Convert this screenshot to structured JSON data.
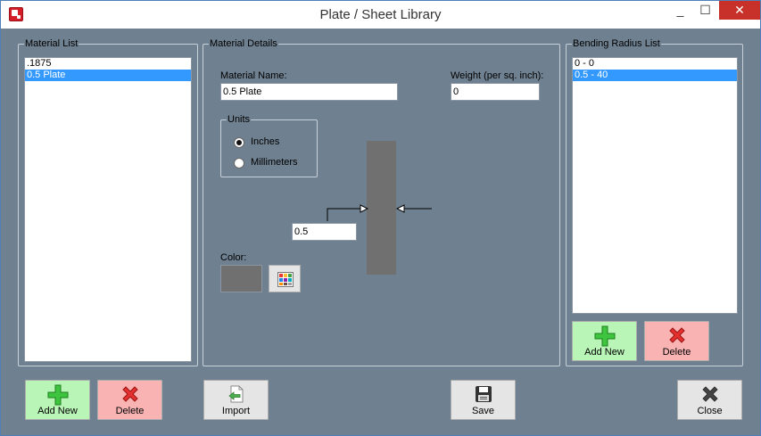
{
  "window": {
    "title": "Plate / Sheet Library",
    "minimize": "_",
    "maximize": "☐",
    "close": "✕"
  },
  "material_list": {
    "label": "Material List",
    "items": [
      ".1875",
      "0.5 Plate"
    ],
    "selected_index": 1,
    "add_label": "Add New",
    "delete_label": "Delete"
  },
  "details": {
    "label": "Material Details",
    "name_label": "Material Name:",
    "name_value": "0.5 Plate",
    "weight_label": "Weight (per sq. inch):",
    "weight_value": "0",
    "units": {
      "label": "Units",
      "options": [
        "Inches",
        "Millimeters"
      ],
      "selected": "Inches"
    },
    "thickness_value": "0.5",
    "color_label": "Color:",
    "color_value": "#707070"
  },
  "bending": {
    "label": "Bending Radius List",
    "items": [
      "0 - 0",
      "0.5 - 40"
    ],
    "selected_index": 1,
    "add_label": "Add New",
    "delete_label": "Delete"
  },
  "footer": {
    "import_label": "Import",
    "save_label": "Save",
    "close_label": "Close"
  },
  "colors": {
    "background": "#6f8090",
    "selection": "#3399ff",
    "add_button": "#b9f5b6",
    "delete_button": "#f9b3b3"
  }
}
